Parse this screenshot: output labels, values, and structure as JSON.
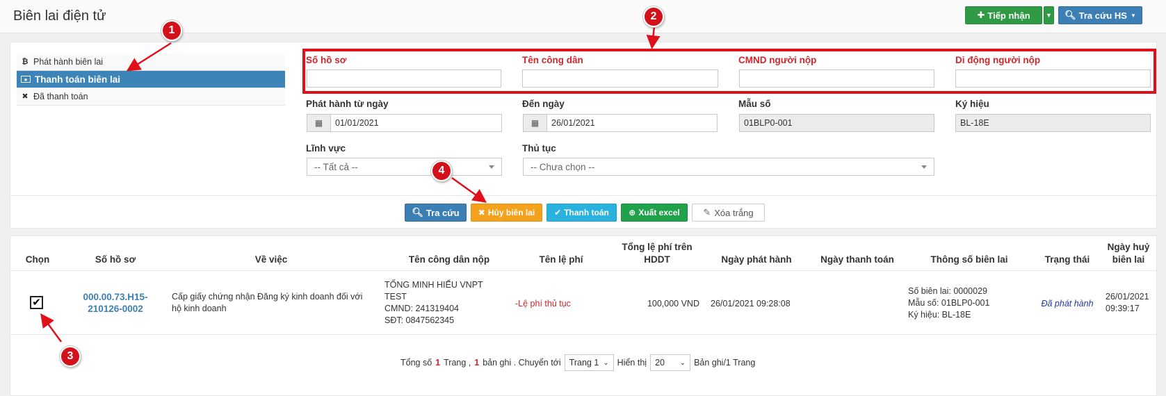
{
  "header": {
    "title": "Biên lai điện tử",
    "tiep_nhan": "Tiếp nhận",
    "tra_cuu_hs": "Tra cứu HS"
  },
  "sidebar": {
    "items": [
      {
        "label": "Phát hành biên lai",
        "icon": "bitcoin-icon"
      },
      {
        "label": "Thanh toán biên lai",
        "icon": "money-icon"
      },
      {
        "label": "Đã thanh toán",
        "icon": "close-icon"
      }
    ]
  },
  "filters": {
    "so_ho_so": {
      "label": "Số hồ sơ",
      "value": ""
    },
    "ten_cong_dan": {
      "label": "Tên công dân",
      "value": ""
    },
    "cmnd": {
      "label": "CMND người nộp",
      "value": ""
    },
    "di_dong": {
      "label": "Di động người nộp",
      "value": ""
    },
    "tu_ngay": {
      "label": "Phát hành từ ngày",
      "value": "01/01/2021"
    },
    "den_ngay": {
      "label": "Đến ngày",
      "value": "26/01/2021"
    },
    "mau_so": {
      "label": "Mẫu số",
      "value": "01BLP0-001"
    },
    "ky_hieu": {
      "label": "Ký hiệu",
      "value": "BL-18E"
    },
    "linh_vuc": {
      "label": "Lĩnh vực",
      "value": "-- Tất cả --"
    },
    "thu_tuc": {
      "label": "Thủ tục",
      "value": "-- Chưa chọn --"
    }
  },
  "actions": {
    "tra_cuu": "Tra cứu",
    "huy": "Hủy biên lai",
    "thanh_toan": "Thanh toán",
    "xuat_excel": "Xuất excel",
    "xoa_trang": "Xóa trắng"
  },
  "table": {
    "headers": {
      "chon": "Chọn",
      "so_ho_so": "Số hồ sơ",
      "ve_viec": "Về việc",
      "ten_cong_dan": "Tên công dân nộp",
      "ten_le_phi": "Tên lệ phí",
      "tong_le_phi_1": "Tổng lệ phí trên",
      "tong_le_phi_2": "HDDT",
      "ngay_phat_hanh": "Ngày phát hành",
      "ngay_thanh_toan": "Ngày thanh toán",
      "thong_so": "Thông số biên lai",
      "trang_thai": "Trạng thái",
      "ngay_huy_1": "Ngày huỷ",
      "ngay_huy_2": "biên lai"
    },
    "rows": [
      {
        "checked": true,
        "so_ho_so_1": "000.00.73.H15-",
        "so_ho_so_2": "210126-0002",
        "ve_viec_1": "Cấp giấy chứng nhận Đăng ký kinh doanh đối với",
        "ve_viec_2": "hộ kinh doanh",
        "cong_dan_1": "TỐNG MINH HIẾU VNPT",
        "cong_dan_2": "TEST",
        "cong_dan_3": "CMND: 241319404",
        "cong_dan_4": "SĐT: 0847562345",
        "le_phi": "-Lệ phí thủ tục",
        "tong": "100,000 VND",
        "ngay_phat_hanh": "26/01/2021 09:28:08",
        "ngay_thanh_toan": "",
        "bien_lai": "Số biên lai: 0000029",
        "mau_so": "Mẫu số: 01BLP0-001",
        "ky_hieu": "Ký hiệu: BL-18E",
        "trang_thai": "Đã phát hành",
        "ngay_huy_1": "26/01/2021",
        "ngay_huy_2": "09:39:17"
      }
    ]
  },
  "pager": {
    "tong_so": "Tổng số",
    "pages": "1",
    "trang": "Trang ,",
    "records": "1",
    "ban_ghi": "bản ghi . Chuyển tới",
    "page_select": "Trang 1",
    "hien_thi": "Hiển thị",
    "page_size": "20",
    "ban_ghi_trang": "Bản ghi/1 Trang"
  },
  "markers": [
    "1",
    "2",
    "3",
    "4"
  ],
  "colors": {
    "accent": "#3d84b8",
    "highlight": "#e0101a",
    "required_label": "#d0262c"
  }
}
